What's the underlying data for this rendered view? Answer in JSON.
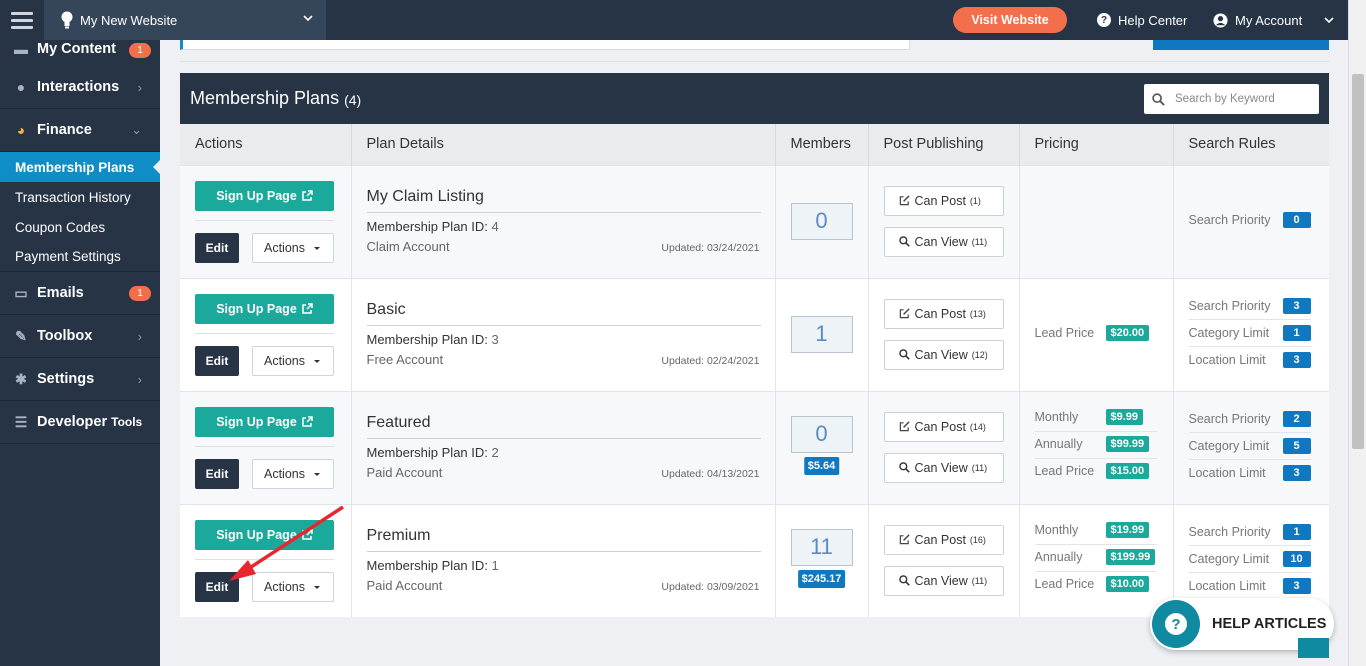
{
  "topbar": {
    "site_name": "My New Website",
    "visit_label": "Visit Website",
    "help_center": "Help Center",
    "my_account": "My Account"
  },
  "sidebar": {
    "items": [
      {
        "label": "My Content",
        "icon": "folder-icon",
        "badge": "1"
      },
      {
        "label": "Interactions",
        "icon": "comments-icon"
      },
      {
        "label": "Finance",
        "icon": "pie-chart-icon"
      }
    ],
    "finance_sub": [
      "Membership Plans",
      "Transaction History",
      "Coupon Codes",
      "Payment Settings"
    ],
    "items2": [
      {
        "label": "Emails",
        "icon": "inbox-icon",
        "badge": "1"
      },
      {
        "label": "Toolbox",
        "icon": "wrench-icon"
      },
      {
        "label": "Settings",
        "icon": "gear-icon"
      },
      {
        "label": "Developer",
        "suffix": "Tools",
        "icon": "sliders-icon"
      }
    ]
  },
  "panel": {
    "title": "Membership Plans",
    "count": "(4)",
    "search_placeholder": "Search by Keyword"
  },
  "columns": [
    "Actions",
    "Plan Details",
    "Members",
    "Post Publishing",
    "Pricing",
    "Search Rules"
  ],
  "plans": [
    {
      "signup": "Sign Up Page",
      "edit": "Edit",
      "actions": "Actions",
      "name": "My Claim Listing",
      "id_label": "Membership Plan ID:",
      "id": "4",
      "type": "Claim Account",
      "updated": "Updated: 03/24/2021",
      "members": "0",
      "revenue": "",
      "can_post": "Can Post",
      "post_count": "(1)",
      "can_view": "Can View",
      "view_count": "(11)",
      "pricing": [],
      "rules": [
        {
          "label": "Search Priority",
          "value": "0"
        }
      ]
    },
    {
      "signup": "Sign Up Page",
      "edit": "Edit",
      "actions": "Actions",
      "name": "Basic",
      "id_label": "Membership Plan ID:",
      "id": "3",
      "type": "Free Account",
      "updated": "Updated: 02/24/2021",
      "members": "1",
      "revenue": "",
      "can_post": "Can Post",
      "post_count": "(13)",
      "can_view": "Can View",
      "view_count": "(12)",
      "pricing": [
        {
          "label": "Lead Price",
          "value": "$20.00"
        }
      ],
      "rules": [
        {
          "label": "Search Priority",
          "value": "3"
        },
        {
          "label": "Category Limit",
          "value": "1"
        },
        {
          "label": "Location Limit",
          "value": "3"
        }
      ]
    },
    {
      "signup": "Sign Up Page",
      "edit": "Edit",
      "actions": "Actions",
      "name": "Featured",
      "id_label": "Membership Plan ID:",
      "id": "2",
      "type": "Paid Account",
      "updated": "Updated: 04/13/2021",
      "members": "0",
      "revenue": "$5.64",
      "can_post": "Can Post",
      "post_count": "(14)",
      "can_view": "Can View",
      "view_count": "(11)",
      "pricing": [
        {
          "label": "Monthly",
          "value": "$9.99"
        },
        {
          "label": "Annually",
          "value": "$99.99"
        },
        {
          "label": "Lead Price",
          "value": "$15.00"
        }
      ],
      "rules": [
        {
          "label": "Search Priority",
          "value": "2"
        },
        {
          "label": "Category Limit",
          "value": "5"
        },
        {
          "label": "Location Limit",
          "value": "3"
        }
      ]
    },
    {
      "signup": "Sign Up Page",
      "edit": "Edit",
      "actions": "Actions",
      "name": "Premium",
      "id_label": "Membership Plan ID:",
      "id": "1",
      "type": "Paid Account",
      "updated": "Updated: 03/09/2021",
      "members": "11",
      "revenue": "$245.17",
      "can_post": "Can Post",
      "post_count": "(16)",
      "can_view": "Can View",
      "view_count": "(11)",
      "pricing": [
        {
          "label": "Monthly",
          "value": "$19.99"
        },
        {
          "label": "Annually",
          "value": "$199.99"
        },
        {
          "label": "Lead Price",
          "value": "$10.00"
        }
      ],
      "rules": [
        {
          "label": "Search Priority",
          "value": "1"
        },
        {
          "label": "Category Limit",
          "value": "10"
        },
        {
          "label": "Location Limit",
          "value": "3"
        }
      ]
    }
  ],
  "help": {
    "label": "HELP ARTICLES"
  },
  "annotation": {
    "color": "#e8262d"
  }
}
